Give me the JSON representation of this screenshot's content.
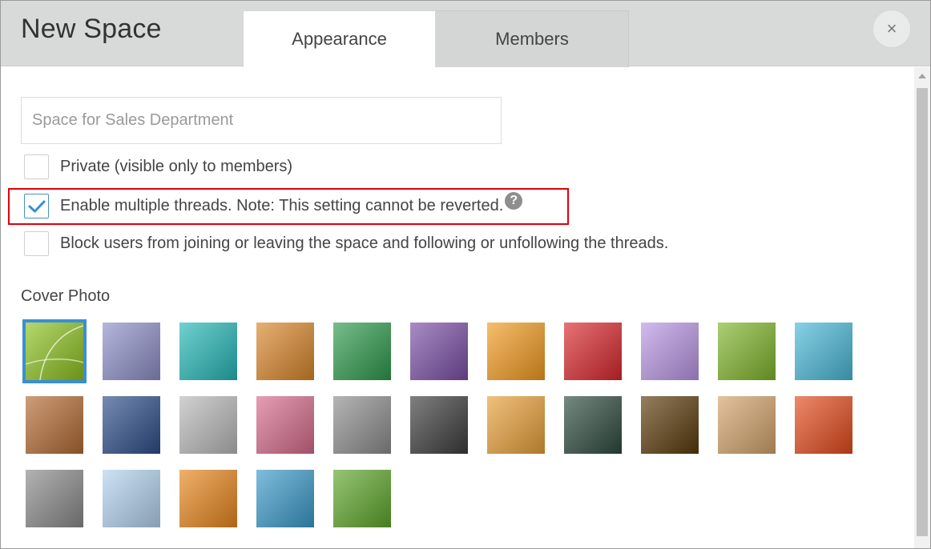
{
  "header": {
    "title": "New Space",
    "tabs": [
      {
        "label": "Appearance",
        "active": true
      },
      {
        "label": "Members",
        "active": false
      }
    ],
    "close_glyph": "×"
  },
  "form": {
    "name_placeholder": "Space for Sales Department",
    "name_value": "",
    "options": [
      {
        "label": "Private (visible only to members)",
        "checked": false
      },
      {
        "label": "Enable multiple threads. Note: This setting cannot be reverted.",
        "checked": true,
        "help_glyph": "?"
      },
      {
        "label": "Block users from joining or leaving the space and following or unfollowing the threads.",
        "checked": false
      }
    ],
    "cover_photo_label": "Cover Photo",
    "selected_cover_index": 0,
    "covers": [
      {
        "name": "green-lines",
        "color": "#8dc21f"
      },
      {
        "name": "lavender-gradient",
        "color": "#8c8fc8"
      },
      {
        "name": "turquoise-water",
        "color": "#25b7b7"
      },
      {
        "name": "orange-canvas",
        "color": "#d9862a"
      },
      {
        "name": "green-fabric",
        "color": "#2e9a4c"
      },
      {
        "name": "purple-paper",
        "color": "#7a4fa6"
      },
      {
        "name": "orange-flower",
        "color": "#f29b1f"
      },
      {
        "name": "red-flower",
        "color": "#d9272c"
      },
      {
        "name": "purple-flower",
        "color": "#b996e4"
      },
      {
        "name": "green-leaf",
        "color": "#7fb52b"
      },
      {
        "name": "blue-cubes",
        "color": "#49b8d8"
      },
      {
        "name": "woven-wood",
        "color": "#b36a32"
      },
      {
        "name": "blue-mosaic",
        "color": "#2c4d88"
      },
      {
        "name": "compass",
        "color": "#b9b9b9"
      },
      {
        "name": "books",
        "color": "#d66b8c"
      },
      {
        "name": "gears",
        "color": "#8d8d8d"
      },
      {
        "name": "chalk-question-marks",
        "color": "#3c3c3c"
      },
      {
        "name": "colored-pencils",
        "color": "#e8a038"
      },
      {
        "name": "light-bulb-chalkboard",
        "color": "#2d4a3e"
      },
      {
        "name": "dark-gradient",
        "color": "#5a3a0a"
      },
      {
        "name": "coffee-cup",
        "color": "#d3a36a"
      },
      {
        "name": "vegetables",
        "color": "#e34a1b"
      },
      {
        "name": "cat-and-dog",
        "color": "#8a8a8a"
      },
      {
        "name": "snowy-trees",
        "color": "#b3d2ee"
      },
      {
        "name": "pumpkins",
        "color": "#e8861c"
      },
      {
        "name": "palm-beach",
        "color": "#3a9ac9"
      },
      {
        "name": "bamboo",
        "color": "#5ea62a"
      }
    ]
  },
  "colors": {
    "accent": "#3a8fd3",
    "highlight_border": "#e0000a",
    "header_bg": "#d8dada"
  }
}
